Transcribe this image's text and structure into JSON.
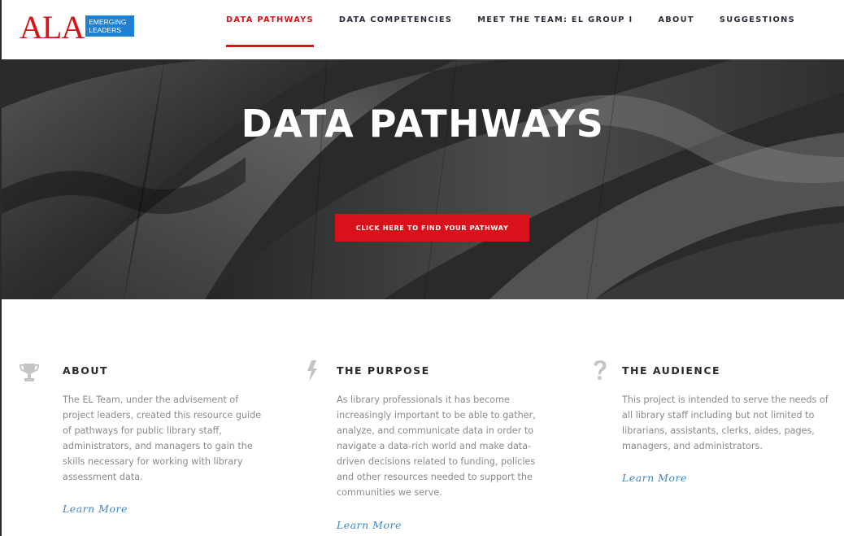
{
  "brand": {
    "logo_main": "ALA",
    "logo_sub_line1": "EMERGING",
    "logo_sub_line2": "LEADERS",
    "accent_color": "#d8111b",
    "logo_box_color": "#1f7fd1"
  },
  "nav": {
    "items": [
      {
        "label": "DATA PATHWAYS",
        "active": true
      },
      {
        "label": "DATA COMPETENCIES",
        "active": false
      },
      {
        "label": "MEET THE TEAM: EL GROUP I",
        "active": false
      },
      {
        "label": "ABOUT",
        "active": false
      },
      {
        "label": "SUGGESTIONS",
        "active": false
      }
    ]
  },
  "hero": {
    "title": "DATA PATHWAYS",
    "button_label": "CLICK HERE TO FIND YOUR PATHWAY"
  },
  "features": [
    {
      "icon": "trophy-icon",
      "title": "ABOUT",
      "lines": [
        "The EL Team, under the advisement of",
        "project leaders, created this resource guide",
        "of pathways for public library staff,",
        "administrators, and managers to gain the",
        "skills necessary for working with library",
        "assessment data."
      ],
      "link": "Learn More"
    },
    {
      "icon": "lightning-bolt-icon",
      "title": "THE PURPOSE",
      "lines": [
        "As library professionals it has become",
        "increasingly important to be able to gather,",
        "analyze, and communicate data in order to",
        "navigate a data-rich world and make data-",
        "driven decisions related to funding, policies",
        "and other resources needed to support the",
        "communities we serve."
      ],
      "link": "Learn More"
    },
    {
      "icon": "question-mark-icon",
      "title": "THE AUDIENCE",
      "lines": [
        "This project is intended to serve the needs of",
        "all library staff including but not limited to",
        "librarians, assistants, clerks, aides, pages,",
        "managers, and administrators."
      ],
      "link": "Learn More"
    }
  ]
}
